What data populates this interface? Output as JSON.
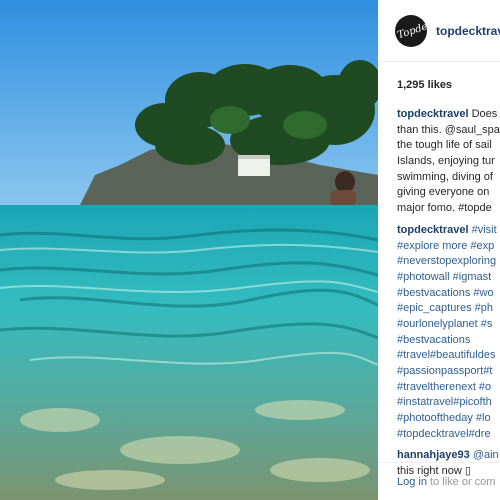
{
  "post": {
    "username": "topdecktravel",
    "avatar_text": "Topdeck",
    "likes": "1,295 likes"
  },
  "caption": {
    "user": "topdecktravel",
    "lines": [
      "Does",
      "than this. @saul_spa",
      "the tough life of sail",
      "Islands, enjoying tur",
      "swimming, diving of",
      "giving everyone on",
      "major fomo. #topde"
    ]
  },
  "comment1": {
    "user": "topdecktravel",
    "lines": [
      "#visit",
      "#explore more #exp",
      "#neverstopexploring",
      "#photowall #igmast",
      "#bestvacations #wo",
      "#epic_captures #ph",
      "#ourlonelyplanet #s",
      "#bestvacations",
      "#travel#beautifuldes",
      "#passionpassport#t",
      "#traveltherenext #o",
      "#instatravel#picofth",
      "#photooftheday #lo",
      "#topdecktravel#dre"
    ]
  },
  "comment2": {
    "user": "hannahjaye93",
    "lines": [
      "@ain",
      "this right now ▯"
    ]
  },
  "footer": {
    "login_link": "Log in",
    "login_rest": " to like or com"
  },
  "colors": {
    "username": "#1e3f66",
    "hashtag": "#2f5f92",
    "sky": "#3ea0e6",
    "sea": "#27b5c0"
  }
}
